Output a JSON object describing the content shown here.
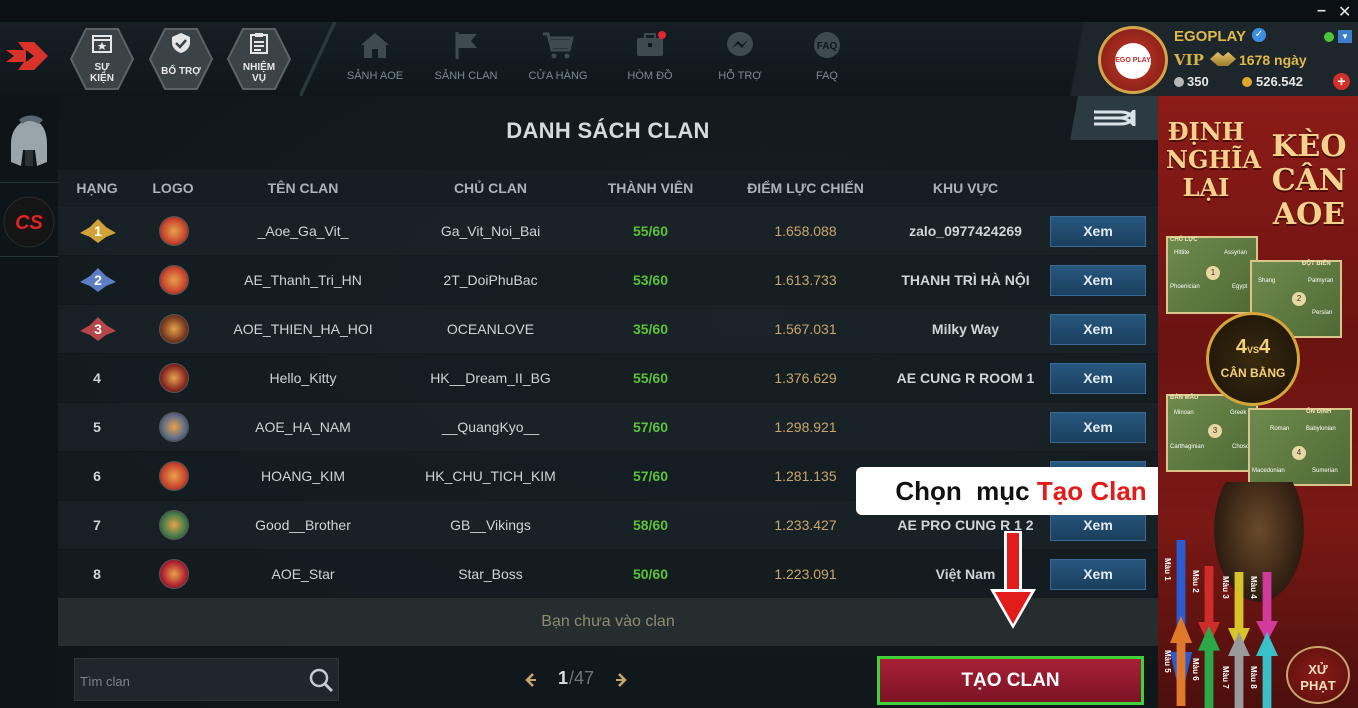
{
  "window": {
    "minimize": "–",
    "close": "✕"
  },
  "topbar": {
    "hex_buttons": [
      {
        "icon": "calendar-star-icon",
        "label1": "SỰ",
        "label2": "KIỆN"
      },
      {
        "icon": "shield-check-icon",
        "label1": "BỔ TRỢ",
        "label2": ""
      },
      {
        "icon": "clipboard-list-icon",
        "label1": "NHIỆM",
        "label2": "VỤ"
      }
    ],
    "nav": [
      {
        "icon": "home-icon",
        "label": "SẢNH AOE"
      },
      {
        "icon": "flag-icon",
        "label": "SẢNH CLAN"
      },
      {
        "icon": "cart-icon",
        "label": "CỬA HÀNG"
      },
      {
        "icon": "chest-icon",
        "label": "HÒM ĐỒ"
      },
      {
        "icon": "messenger-icon",
        "label": "HỖ TRỢ"
      },
      {
        "icon": "faq-icon",
        "label": "FAQ"
      }
    ],
    "profile": {
      "name": "EGOPLAY",
      "avatar_text": "EGO PLAY",
      "vip": "VIP",
      "days": "1678 ngày",
      "silver": "350",
      "gold": "526.542"
    }
  },
  "panel": {
    "title": "DANH SÁCH CLAN",
    "columns": [
      "HẠNG",
      "LOGO",
      "TÊN CLAN",
      "CHỦ CLAN",
      "THÀNH VIÊN",
      "ĐIỂM LỰC CHIẾN",
      "KHU VỰC"
    ],
    "rows": [
      {
        "rank": "1",
        "logo_color": "#c8442e",
        "name": "_Aoe_Ga_Vit_",
        "owner": "Ga_Vit_Noi_Bai",
        "members": "55/60",
        "power": "1.658.088",
        "region": "zalo_0977424269",
        "action": "Xem"
      },
      {
        "rank": "2",
        "logo_color": "#c8442e",
        "name": "AE_Thanh_Tri_HN",
        "owner": "2T_DoiPhuBac",
        "members": "53/60",
        "power": "1.613.733",
        "region": "THANH TRÌ HÀ NỘI",
        "action": "Xem"
      },
      {
        "rank": "3",
        "logo_color": "#7a3a20",
        "name": "AOE_THIEN_HA_HOI",
        "owner": "OCEANLOVE",
        "members": "35/60",
        "power": "1.567.031",
        "region": "Milky Way",
        "action": "Xem"
      },
      {
        "rank": "4",
        "logo_color": "#8a2a22",
        "name": "Hello_Kitty",
        "owner": "HK__Dream_II_BG",
        "members": "55/60",
        "power": "1.376.629",
        "region": "AE CUNG R ROOM 1",
        "action": "Xem"
      },
      {
        "rank": "5",
        "logo_color": "#5a6a88",
        "name": "AOE_HA_NAM",
        "owner": "__QuangKyo__",
        "members": "57/60",
        "power": "1.298.921",
        "region": "",
        "action": "Xem"
      },
      {
        "rank": "6",
        "logo_color": "#c8442e",
        "name": "HOANG_KIM",
        "owner": "HK_CHU_TICH_KIM",
        "members": "57/60",
        "power": "1.281.135",
        "region": "",
        "action": "Xem"
      },
      {
        "rank": "7",
        "logo_color": "#3f7a4a",
        "name": "Good__Brother",
        "owner": "GB__Vikings",
        "members": "58/60",
        "power": "1.233.427",
        "region": "AE PRO CUNG R 1 2",
        "action": "Xem"
      },
      {
        "rank": "8",
        "logo_color": "#b02030",
        "name": "AOE_Star",
        "owner": "Star_Boss",
        "members": "50/60",
        "power": "1.223.091",
        "region": "Việt Nam",
        "action": "Xem"
      }
    ],
    "status": "Bạn chưa vào clan",
    "search_placeholder": "Tìm clan",
    "page_current": "1",
    "page_total": "/47",
    "create_button": "TẠO CLAN"
  },
  "callout": {
    "prefix": "Chọn  mục ",
    "highlight": "Tạo Clan"
  },
  "ad": {
    "left_title": [
      "ĐỊNH",
      "NGHĨA",
      "LẠI"
    ],
    "right_title": [
      "KÈO",
      "CÂN",
      "AOE"
    ],
    "cards": [
      {
        "caption": "CHỦ LỰC",
        "a": "Hittite",
        "b": "Assyrian",
        "c": "Phoenician",
        "d": "Egypt",
        "num": "1"
      },
      {
        "caption": "ĐỘT BIẾN",
        "a": "Shang",
        "b": "Palmyran",
        "c": "",
        "d": "Persian",
        "num": "2"
      },
      {
        "caption": "BẢN MẪU",
        "a": "Minoan",
        "b": "Greek",
        "c": "Carthaginian",
        "d": "Choson",
        "num": "3"
      },
      {
        "caption": "ỔN ĐỊNH",
        "a": "Roman",
        "b": "Babylonian",
        "c": "Macedonian",
        "d": "Sumerian",
        "num": "4"
      }
    ],
    "vs_top": "4",
    "vs_mid": "VS",
    "vs_right": "4",
    "vs_label": "CÂN BẰNG",
    "teams": [
      "Màu 1",
      "Màu 2",
      "Màu 3",
      "Màu 4",
      "Màu 5",
      "Màu 6",
      "Màu 7",
      "Màu 8"
    ],
    "xu_phat": [
      "XỬ",
      "PHẠT"
    ]
  },
  "colors": {
    "accent_green": "#3fd33b",
    "create_red": "#a82035",
    "highlight_red": "#e21b1b",
    "member_green": "#5cc13a"
  }
}
